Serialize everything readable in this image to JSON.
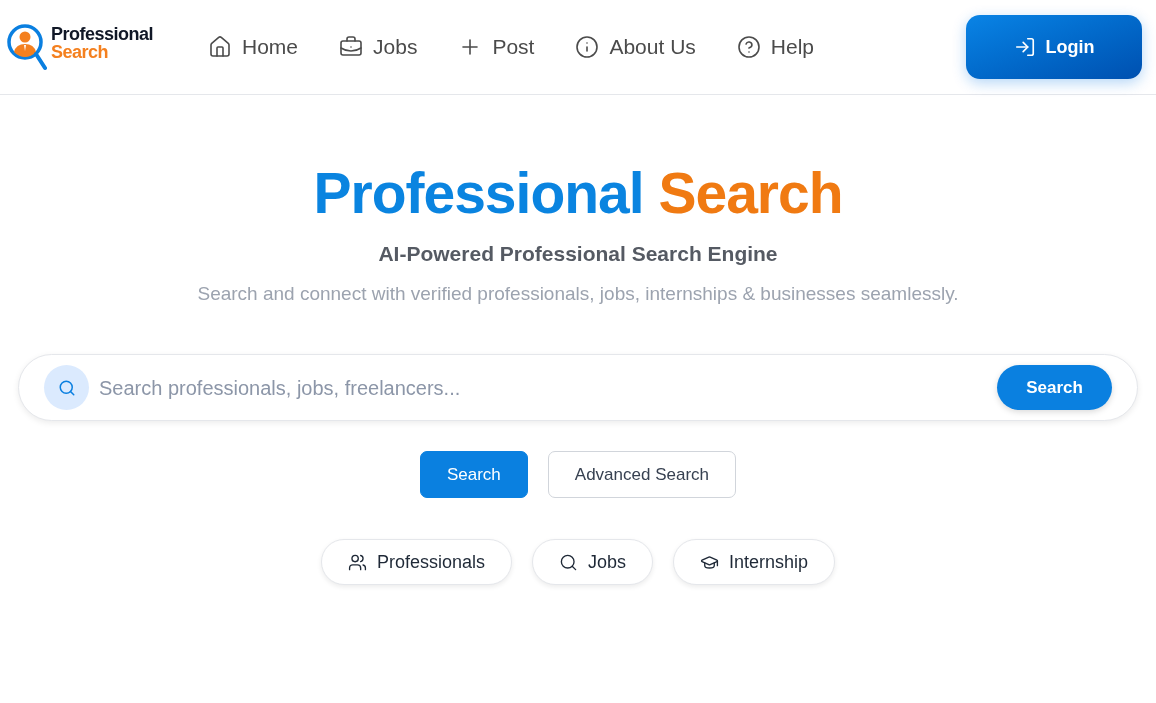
{
  "header": {
    "logo": {
      "line_1": "Professional",
      "line_2": "Search"
    },
    "nav": [
      {
        "label": "Home"
      },
      {
        "label": "Jobs"
      },
      {
        "label": "Post"
      },
      {
        "label": "About Us"
      },
      {
        "label": "Help"
      }
    ],
    "login_button": "Login"
  },
  "hero": {
    "title": {
      "part_1": "Professional",
      "part_2": "Search"
    },
    "subtitle": "AI-Powered Professional Search Engine",
    "description": "Search and connect with verified professionals, jobs, internships & businesses seamlessly."
  },
  "search_bar": {
    "placeholder": "Search professionals, jobs, freelancers...",
    "button": "Search"
  },
  "actions": [
    {
      "label": "Search",
      "kind": "primary"
    },
    {
      "label": "Advanced Search",
      "kind": "secondary"
    }
  ],
  "categories": [
    {
      "label": "Professionals"
    },
    {
      "label": "Jobs"
    },
    {
      "label": "Internship"
    }
  ]
}
